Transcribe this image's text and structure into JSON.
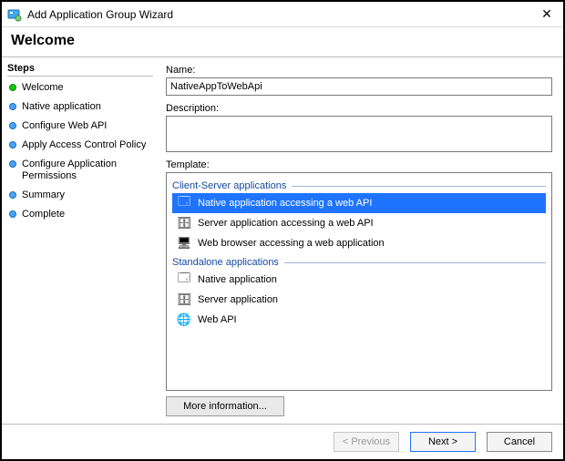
{
  "window": {
    "title": "Add Application Group Wizard",
    "close_glyph": "✕"
  },
  "heading": "Welcome",
  "steps": {
    "heading": "Steps",
    "items": [
      {
        "label": "Welcome",
        "state": "current"
      },
      {
        "label": "Native application",
        "state": "todo"
      },
      {
        "label": "Configure Web API",
        "state": "todo"
      },
      {
        "label": "Apply Access Control Policy",
        "state": "todo"
      },
      {
        "label": "Configure Application Permissions",
        "state": "todo"
      },
      {
        "label": "Summary",
        "state": "todo"
      },
      {
        "label": "Complete",
        "state": "todo"
      }
    ]
  },
  "form": {
    "name_label": "Name:",
    "name_value": "NativeAppToWebApi",
    "description_label": "Description:",
    "description_value": "",
    "template_label": "Template:",
    "more_info": "More information..."
  },
  "templates": {
    "group1": "Client-Server applications",
    "group2": "Standalone applications",
    "items_cs": [
      {
        "label": "Native application accessing a web API",
        "icon": "🗔",
        "selected": true
      },
      {
        "label": "Server application accessing a web API",
        "icon": "🗄",
        "selected": false
      },
      {
        "label": "Web browser accessing a web application",
        "icon": "🖥",
        "selected": false
      }
    ],
    "items_sa": [
      {
        "label": "Native application",
        "icon": "🗔"
      },
      {
        "label": "Server application",
        "icon": "🗄"
      },
      {
        "label": "Web API",
        "icon": "🌐"
      }
    ]
  },
  "buttons": {
    "previous": "< Previous",
    "next": "Next >",
    "cancel": "Cancel"
  }
}
